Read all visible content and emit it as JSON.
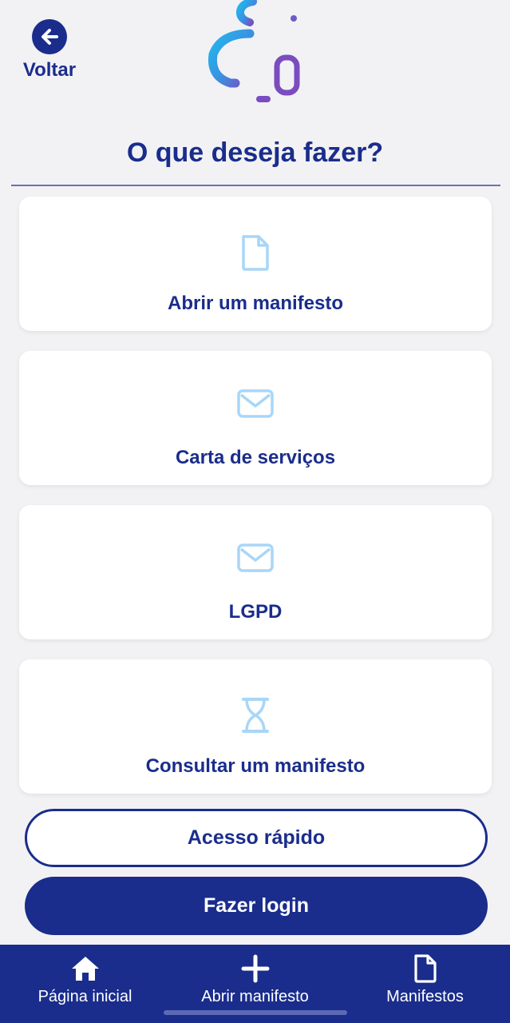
{
  "header": {
    "back_label": "Voltar",
    "title": "O que deseja fazer?"
  },
  "options": [
    {
      "label": "Abrir um manifesto",
      "icon": "document-icon"
    },
    {
      "label": "Carta de serviços",
      "icon": "envelope-icon"
    },
    {
      "label": "LGPD",
      "icon": "envelope-icon"
    },
    {
      "label": "Consultar um manifesto",
      "icon": "hourglass-icon"
    }
  ],
  "buttons": {
    "quick_access": "Acesso rápido",
    "login": "Fazer login"
  },
  "bottom_nav": [
    {
      "label": "Página inicial",
      "icon": "home-icon"
    },
    {
      "label": "Abrir manifesto",
      "icon": "plus-icon"
    },
    {
      "label": "Manifestos",
      "icon": "document-icon"
    }
  ],
  "colors": {
    "primary": "#1a2d8c",
    "background": "#f2f2f4",
    "card": "#ffffff",
    "icon_light": "#a9d6f7"
  }
}
